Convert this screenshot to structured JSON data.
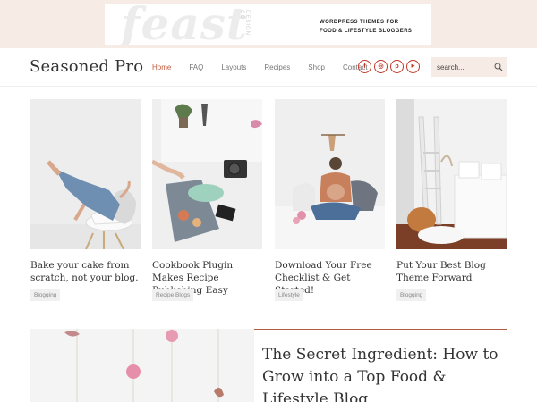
{
  "banner": {
    "logo_text": "feast",
    "vertical_text": "DESIGN CO",
    "tagline_line1": "WORDPRESS THEMES FOR",
    "tagline_line2": "FOOD & LIFESTYLE BLOGGERS",
    "background_color": "#f7ece5"
  },
  "header": {
    "site_title": "Seasoned Pro",
    "nav": [
      {
        "label": "Home",
        "active": true
      },
      {
        "label": "FAQ",
        "active": false
      },
      {
        "label": "Layouts",
        "active": false
      },
      {
        "label": "Recipes",
        "active": false
      },
      {
        "label": "Shop",
        "active": false
      },
      {
        "label": "Contact",
        "active": false
      }
    ],
    "socials": [
      {
        "name": "facebook-icon",
        "glyph": "f"
      },
      {
        "name": "instagram-icon",
        "glyph": "◎"
      },
      {
        "name": "pinterest-icon",
        "glyph": "p"
      },
      {
        "name": "youtube-icon",
        "glyph": "▶"
      }
    ],
    "search_placeholder": "search...",
    "accent_color": "#c0392b"
  },
  "posts": [
    {
      "title": "Bake your cake from scratch, not your blog.",
      "category": "Blogging"
    },
    {
      "title": "Cookbook Plugin Makes Recipe Publishing Easy",
      "category": "Recipe Blogs"
    },
    {
      "title": "Download Your Free Checklist & Get Started!",
      "category": "Lifestyle"
    },
    {
      "title": "Put Your Best Blog Theme Forward",
      "category": "Blogging"
    }
  ],
  "featured": {
    "title": "The Secret Ingredient: How to Grow into a Top Food & Lifestyle Blog"
  }
}
